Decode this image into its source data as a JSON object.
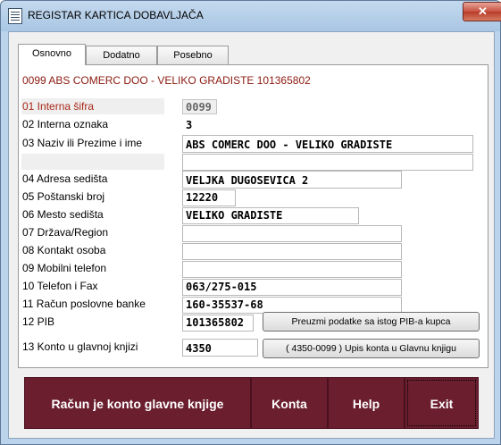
{
  "window": {
    "title": "REGISTAR KARTICA DOBAVLJAČA",
    "close_label": "✕"
  },
  "tabs": [
    {
      "label": "Osnovno",
      "active": true
    },
    {
      "label": "Dodatno",
      "active": false
    },
    {
      "label": "Posebno",
      "active": false
    }
  ],
  "header": "0099 ABS COMERC DOO - VELIKO GRADISTE 101365802",
  "fields": [
    {
      "label": "01 Interna šifra",
      "value": "0099"
    },
    {
      "label": "02 Interna oznaka",
      "value": "3"
    },
    {
      "label": "03 Naziv ili Prezime i ime",
      "value": "ABS COMERC DOO - VELIKO GRADISTE",
      "value2": ""
    },
    {
      "label": "04 Adresa sedišta",
      "value": "VELJKA DUGOSEVICA 2"
    },
    {
      "label": "05 Poštanski broj",
      "value": "12220"
    },
    {
      "label": "06 Mesto sedišta",
      "value": "VELIKO GRADISTE"
    },
    {
      "label": "07 Država/Region",
      "value": ""
    },
    {
      "label": "08 Kontakt osoba",
      "value": ""
    },
    {
      "label": "09 Mobilni telefon",
      "value": ""
    },
    {
      "label": "10 Telefon i Fax",
      "value": "063/275-015"
    },
    {
      "label": "11 Račun poslovne banke",
      "value": "160-35537-68"
    },
    {
      "label": "12 PIB",
      "value": "101365802"
    },
    {
      "label": "13 Konto u glavnoj knjizi",
      "value": "4350"
    }
  ],
  "small_buttons": {
    "pib": "Preuzmi podatke sa istog PIB-a kupca",
    "konto": "( 4350-0099 ) Upis konta u Glavnu knjigu"
  },
  "bottom_buttons": {
    "racun": "Račun je konto glavne knjige",
    "konta": "Konta",
    "help": "Help",
    "exit": "Exit"
  },
  "colors": {
    "accent_label": "#a82818",
    "button_bg": "#6a1e2e"
  }
}
